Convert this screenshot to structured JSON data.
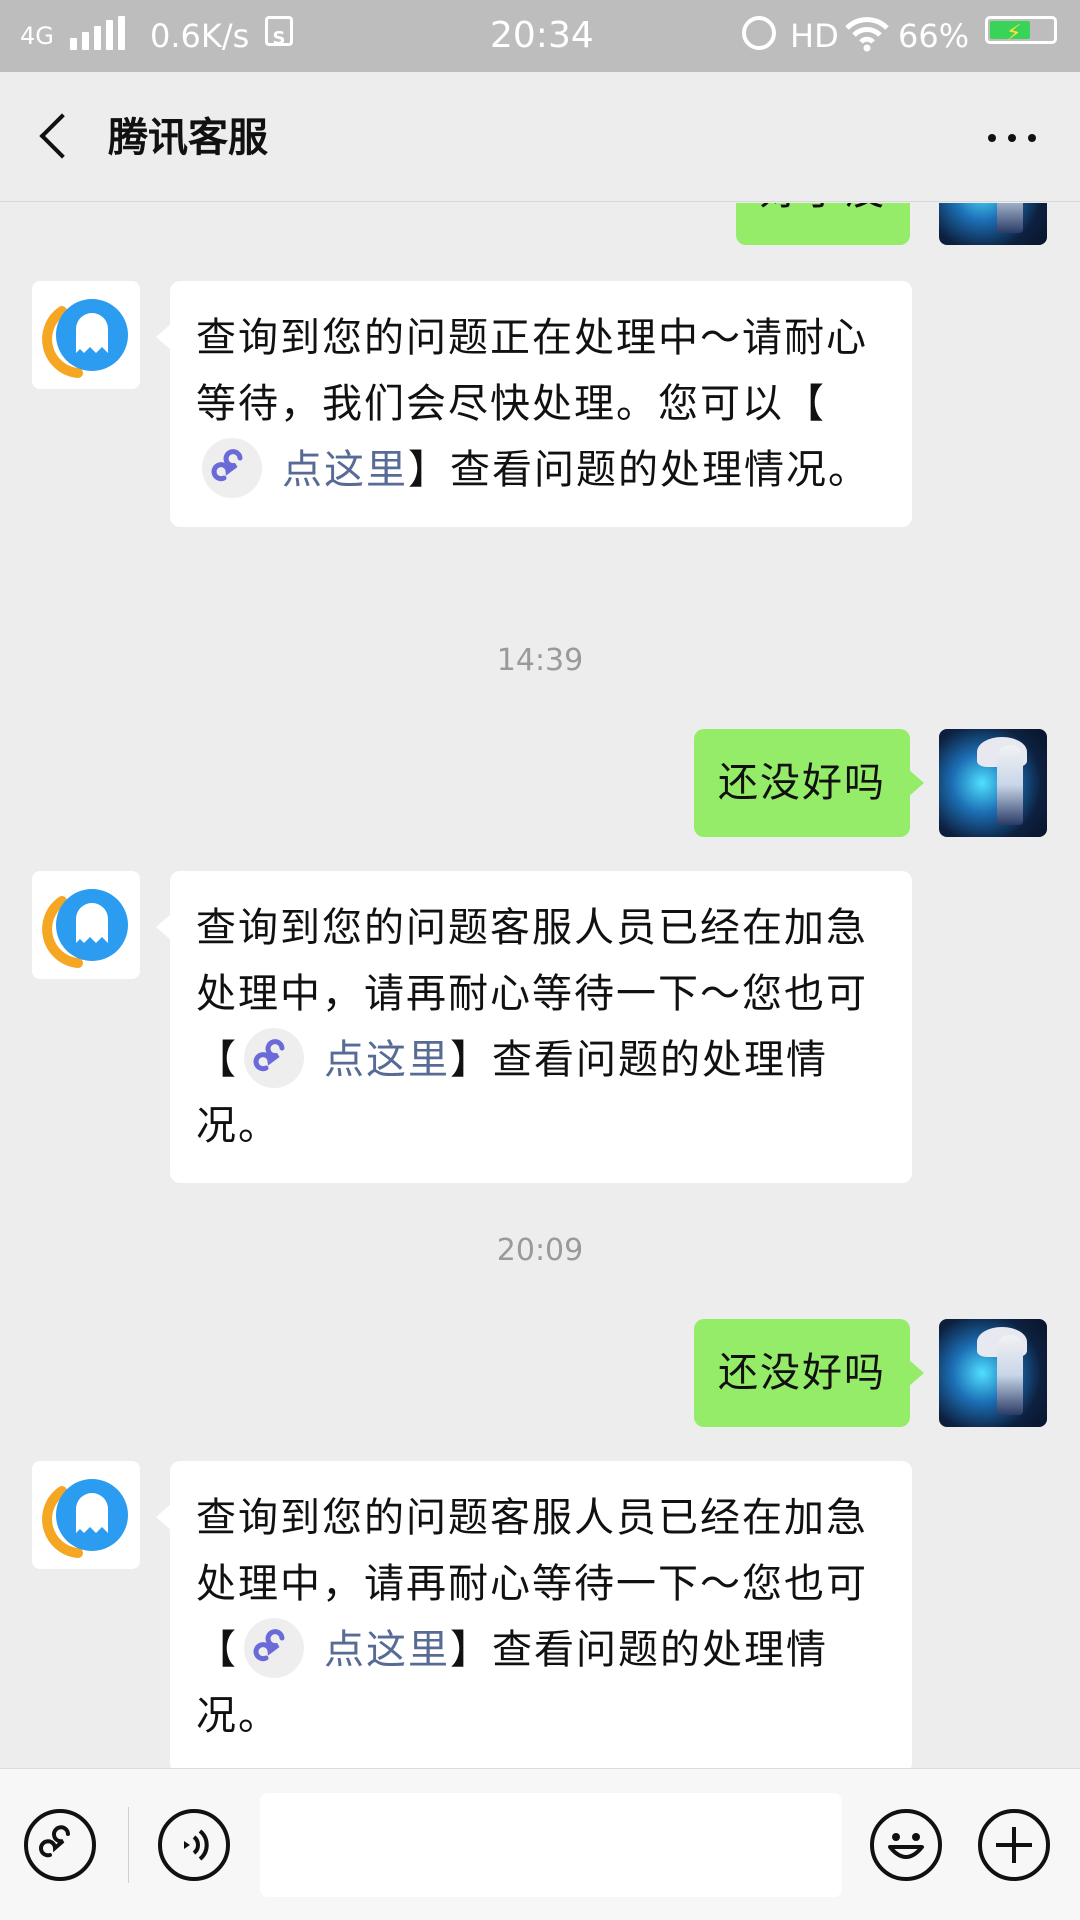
{
  "status_bar": {
    "network": "4G",
    "speed": "0.6K/s",
    "sim_icon": "sim-card-icon",
    "sim_label": "S",
    "time": "20:34",
    "hd": "HD",
    "battery": "66%"
  },
  "header": {
    "title": "腾讯客服",
    "back_icon": "chevron-left-icon",
    "more_icon": "more-dots-icon"
  },
  "messages": [
    {
      "from": "user",
      "text": "好了没"
    },
    {
      "from": "bot",
      "pre": "查询到您的问题正在处理中～请耐心等待，我们会尽快处理。您可以【",
      "link": "点这里",
      "post": "】查看问题的处理情况。"
    },
    {
      "type": "time",
      "text": "14:39"
    },
    {
      "from": "user",
      "text": "还没好吗"
    },
    {
      "from": "bot",
      "pre": "查询到您的问题客服人员已经在加急处理中，请再耐心等待一下～您也可【",
      "link": "点这里",
      "post": "】查看问题的处理情况。"
    },
    {
      "type": "time",
      "text": "20:09"
    },
    {
      "from": "user",
      "text": "还没好吗"
    },
    {
      "from": "bot",
      "pre": "查询到您的问题客服人员已经在加急处理中，请再耐心等待一下～您也可【",
      "link": "点这里",
      "post": "】查看问题的处理情况。"
    }
  ],
  "input": {
    "value": "",
    "placeholder": ""
  },
  "icons": {
    "mini_program": "mini-program-icon",
    "voice": "voice-icon",
    "emoji": "emoji-icon",
    "add": "plus-icon"
  },
  "colors": {
    "status_bar_bg": "#bdbdbd",
    "page_bg": "#ededed",
    "outgoing_bubble": "#95ec69",
    "incoming_bubble": "#ffffff",
    "link": "#576b95",
    "mini_program_icon": "#6a6ad8",
    "qq_blue": "#2b9cf0",
    "qq_orange": "#f5a623"
  }
}
